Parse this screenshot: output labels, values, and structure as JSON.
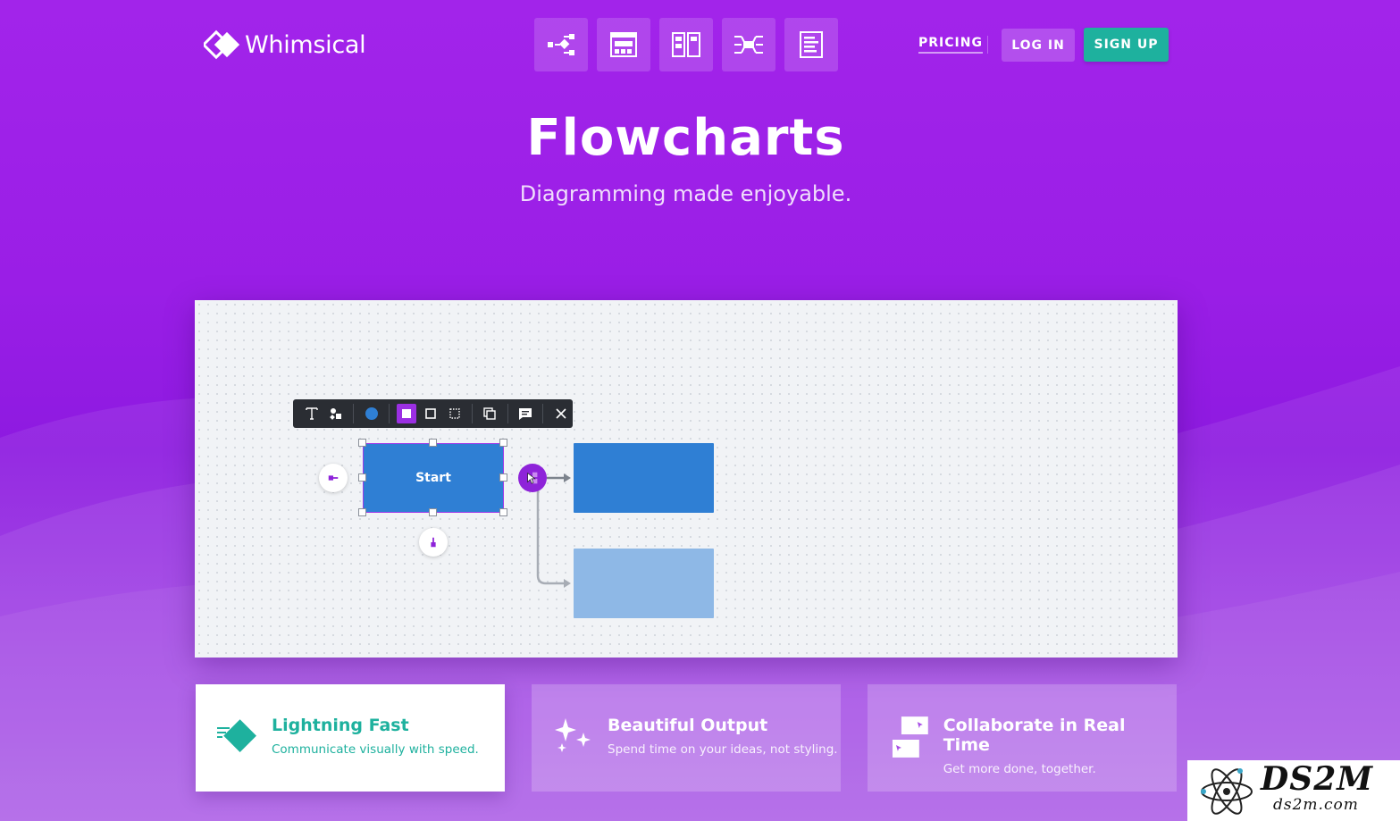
{
  "brand": {
    "name": "Whimsical"
  },
  "header": {
    "tools": [
      {
        "name": "flowchart-tool-icon"
      },
      {
        "name": "wireframe-tool-icon"
      },
      {
        "name": "board-tool-icon"
      },
      {
        "name": "mindmap-tool-icon"
      },
      {
        "name": "docs-tool-icon"
      }
    ],
    "pricing_label": "PRICING",
    "login_label": "LOG IN",
    "signup_label": "SIGN UP"
  },
  "hero": {
    "title": "Flowcharts",
    "subtitle": "Diagramming made enjoyable."
  },
  "canvas": {
    "toolbar_icons": [
      "text-icon",
      "shapes-icon",
      "color-icon",
      "fill-solid-icon",
      "fill-outline-icon",
      "fill-dashed-icon",
      "duplicate-icon",
      "comment-icon",
      "close-icon"
    ],
    "start_node_label": "Start"
  },
  "features": [
    {
      "title": "Lightning Fast",
      "description": "Communicate visually with speed."
    },
    {
      "title": "Beautiful Output",
      "description": "Spend time on your ideas, not styling."
    },
    {
      "title": "Collaborate in Real Time",
      "description": "Get more done, together."
    }
  ],
  "watermark": {
    "main": "DS2M",
    "sub": "ds2m.com"
  },
  "colors": {
    "brand_purple": "#9b1fe8",
    "teal": "#1eb19e",
    "node_blue": "#2f7fd4",
    "node_light_blue": "#8eb8e6"
  }
}
